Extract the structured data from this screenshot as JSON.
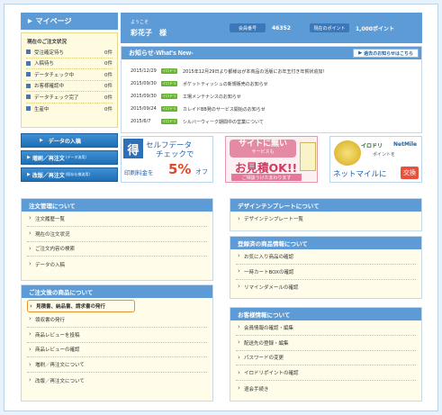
{
  "mypage": {
    "title": "マイページ"
  },
  "status": {
    "title": "現在のご注文状況",
    "rows": [
      {
        "label": "受注確定待ち",
        "count": "0件"
      },
      {
        "label": "入稿待ち",
        "count": "0件"
      },
      {
        "label": "データチェック中",
        "count": "0件"
      },
      {
        "label": "お客様確認中",
        "count": "0件"
      },
      {
        "label": "データチェック完了",
        "count": "0件"
      },
      {
        "label": "生産中",
        "count": "0件"
      }
    ]
  },
  "leftbuttons": {
    "data_entry": "データの入稿",
    "reorder": "増刷／再注文",
    "reorder_note": "(データ流用)",
    "revise": "改版／再注文",
    "revise_note": "(既存仕様流用)"
  },
  "user": {
    "welcome": "ようこそ",
    "name": "彩花子　様",
    "member_label": "会員番号",
    "member_number": "46352",
    "points_label": "現在のポイント",
    "points_value": "1,000ポイント"
  },
  "news": {
    "title": "お知らせ-What's New-",
    "list_button": "過去のお知らせはこちら",
    "items": [
      {
        "date": "2015/12/29",
        "tag": "イロドリ",
        "text": "2015年12月29日より都様はが本商品の活版にお年玉付き年賀状追加！"
      },
      {
        "date": "2015/09/30",
        "tag": "イロドリ",
        "text": "ポケットティッシュの新規販売のお知らせ"
      },
      {
        "date": "2015/09/30",
        "tag": "イロドリ",
        "text": "工場メンテナンスのお知らせ"
      },
      {
        "date": "2015/09/24",
        "tag": "イロドリ",
        "text": "カレイドBB発のサービス開始のお知らせ"
      },
      {
        "date": "2015/6/7",
        "tag": "イロドリ",
        "text": "シルバーウィーク期間中の営業について"
      }
    ]
  },
  "banners": {
    "b1": {
      "badge": "得",
      "line1": "セルフデータ",
      "line2": "チェックで",
      "line3": "印刷料金を",
      "big": "5%",
      "off": "オフ"
    },
    "b2": {
      "top1": "サイトに無い",
      "top2": "サービスも",
      "big": "お見積OK!!",
      "small": "ご相談うけたまわります"
    },
    "b3": {
      "logo1": "イロドリ",
      "logo2": "NetMile",
      "pts": "ポイントを",
      "foot": "ネットマイルに",
      "ex": "交換"
    }
  },
  "order_menu": {
    "title": "注文管理について",
    "items": [
      "注文履歴一覧",
      "現在の注文状況",
      "ご注文内容の検索",
      "データの入稿"
    ]
  },
  "after_menu": {
    "title": "ご注文後の商品について",
    "items": [
      "見積書、納品書、請求書の発行",
      "領収書の発行",
      "商品レビューを投稿",
      "商品レビューの確認",
      "増刷／再注文について",
      "改版／再注文について"
    ]
  },
  "design_menu": {
    "title": "デザインテンプレートについて",
    "items": [
      "デザインテンプレート一覧"
    ]
  },
  "registered_menu": {
    "title": "登録済の商品情報について",
    "items": [
      "お気に入り商品の確認",
      "一時カートBOXの確認",
      "リマインダメールの確認"
    ]
  },
  "customer_menu": {
    "title": "お客様情報について",
    "items": [
      "会員情報の確認・編集",
      "配送先の登録・編集",
      "パスワードの変更",
      "イロドリポイントの確認",
      "退会手続き"
    ]
  },
  "colors": {
    "accent": "#5d9bd6",
    "button": "#1f6fb5",
    "highlight": "#e9922e"
  }
}
